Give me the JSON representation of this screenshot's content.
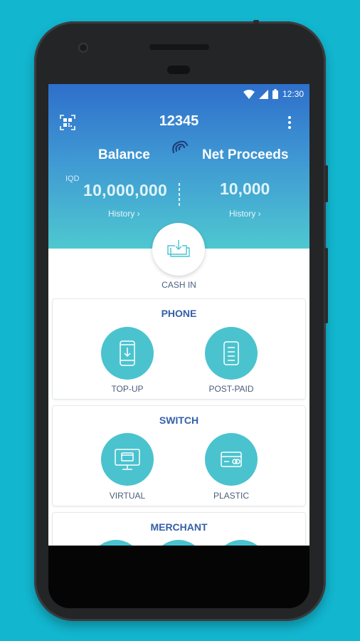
{
  "status_bar": {
    "time": "12:30"
  },
  "header": {
    "account_number": "12345",
    "balance_label": "Balance",
    "net_label": "Net Proceeds",
    "currency": "IQD",
    "balance_value": "10,000,000",
    "net_value": "10,000",
    "history_left": "History ›",
    "history_right": "History ›"
  },
  "cash_in": {
    "label": "CASH IN"
  },
  "sections": {
    "phone": {
      "title": "PHONE",
      "items": [
        {
          "label": "TOP-UP"
        },
        {
          "label": "POST-PAID"
        }
      ]
    },
    "switch": {
      "title": "SWITCH",
      "items": [
        {
          "label": "VIRTUAL"
        },
        {
          "label": "PLASTIC"
        }
      ]
    },
    "merchant": {
      "title": "MERCHANT"
    }
  },
  "colors": {
    "background": "#12b6cf",
    "header_top": "#2e6fcb",
    "header_bottom": "#4ec8d0",
    "accent_circle": "#4ac3cf",
    "section_title": "#3560a8"
  },
  "icons": {
    "qr": "qr-scan-icon",
    "menu": "more-vertical-icon",
    "logo": "swirl-logo-icon",
    "cash_in": "download-tray-icon",
    "top_up": "phone-download-icon",
    "post_paid": "bill-document-icon",
    "virtual": "monitor-card-icon",
    "plastic": "credit-card-icon"
  }
}
